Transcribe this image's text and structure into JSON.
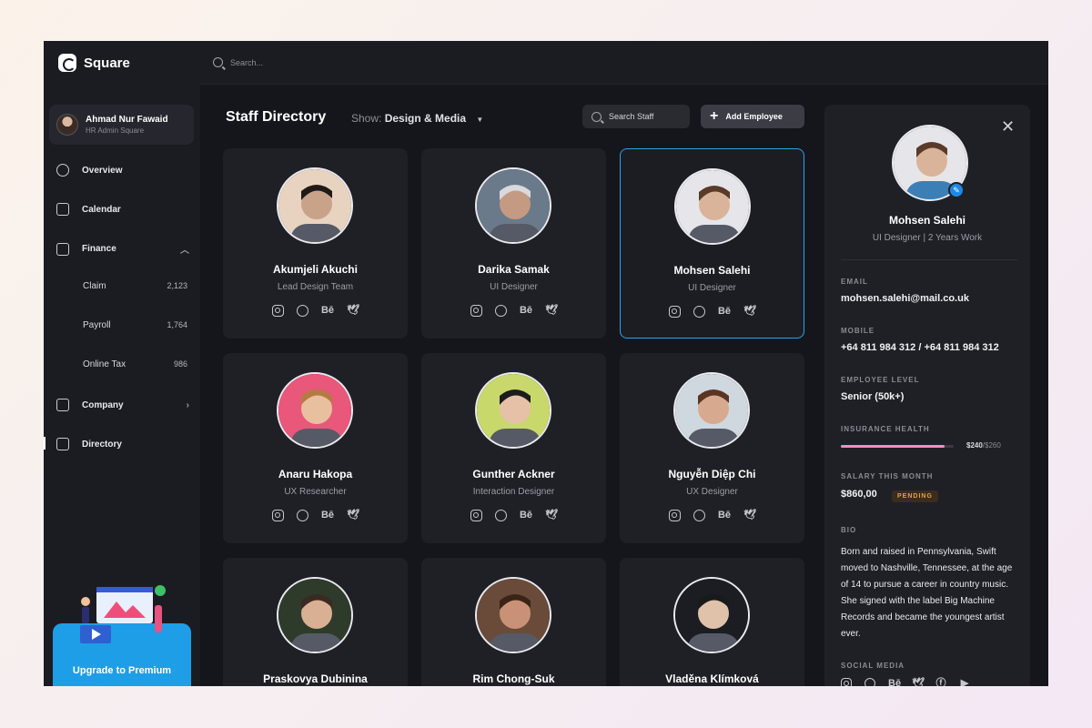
{
  "app": {
    "name": "Square"
  },
  "user": {
    "name": "Ahmad Nur Fawaid",
    "role": "HR Admin Square"
  },
  "sidebar": {
    "items": [
      {
        "label": "Overview"
      },
      {
        "label": "Calendar"
      },
      {
        "label": "Finance"
      },
      {
        "label": "Company"
      },
      {
        "label": "Directory"
      }
    ],
    "finance_sub": [
      {
        "label": "Claim",
        "count": "2,123"
      },
      {
        "label": "Payroll",
        "count": "1,764"
      },
      {
        "label": "Online Tax",
        "count": "986"
      }
    ],
    "promo": {
      "label": "Upgrade to Premium"
    }
  },
  "topbar": {
    "search_placeholder": "Search..."
  },
  "main": {
    "title": "Staff Directory",
    "show_label": "Show:",
    "show_value": "Design & Media",
    "search_staff": "Search Staff",
    "add_employee": "Add Employee"
  },
  "staff": [
    {
      "name": "Akumjeli Akuchi",
      "role": "Lead Design Team"
    },
    {
      "name": "Darika Samak",
      "role": "UI Designer"
    },
    {
      "name": "Mohsen Salehi",
      "role": "UI Designer"
    },
    {
      "name": "Anaru Hakopa",
      "role": "UX Researcher"
    },
    {
      "name": "Gunther Ackner",
      "role": "Interaction Designer"
    },
    {
      "name": "Nguyễn Diệp Chi",
      "role": "UX Designer"
    },
    {
      "name": "Praskovya Dubinina",
      "role": ""
    },
    {
      "name": "Rim Chong-Suk",
      "role": ""
    },
    {
      "name": "Vladěna Klímková",
      "role": ""
    }
  ],
  "social_icons": [
    "instagram-icon",
    "dribbble-icon",
    "behance-icon",
    "twitter-icon"
  ],
  "behance_glyph": "Bē",
  "detail": {
    "name": "Mohsen Salehi",
    "subtitle": "UI Designer | 2 Years Work",
    "email_label": "EMAIL",
    "email": "mohsen.salehi@mail.co.uk",
    "mobile_label": "MOBILE",
    "mobile": "+64 811 984 312 / +64 811 984 312",
    "level_label": "EMPLOYEE LEVEL",
    "level": "Senior (50k+)",
    "insurance_label": "INSURANCE HEALTH",
    "insurance_used": "$240",
    "insurance_total": "/$260",
    "insurance_fraction": 0.92,
    "salary_label": "SALARY THIS MONTH",
    "salary": "$860,00",
    "salary_status": "PENDING",
    "bio_label": "BIO",
    "bio": "Born and raised in Pennsylvania, Swift moved to Nashville, Tennessee, at the age of 14 to pursue a career in country music. She signed with the label Big Machine Records and became the youngest artist ever.",
    "social_label": "SOCIAL MEDIA"
  },
  "colors": {
    "accent": "#2aa4e8",
    "insurance_bar": "#f08ec6",
    "pending": "#e3a245",
    "promo": "#1e9ee6"
  }
}
